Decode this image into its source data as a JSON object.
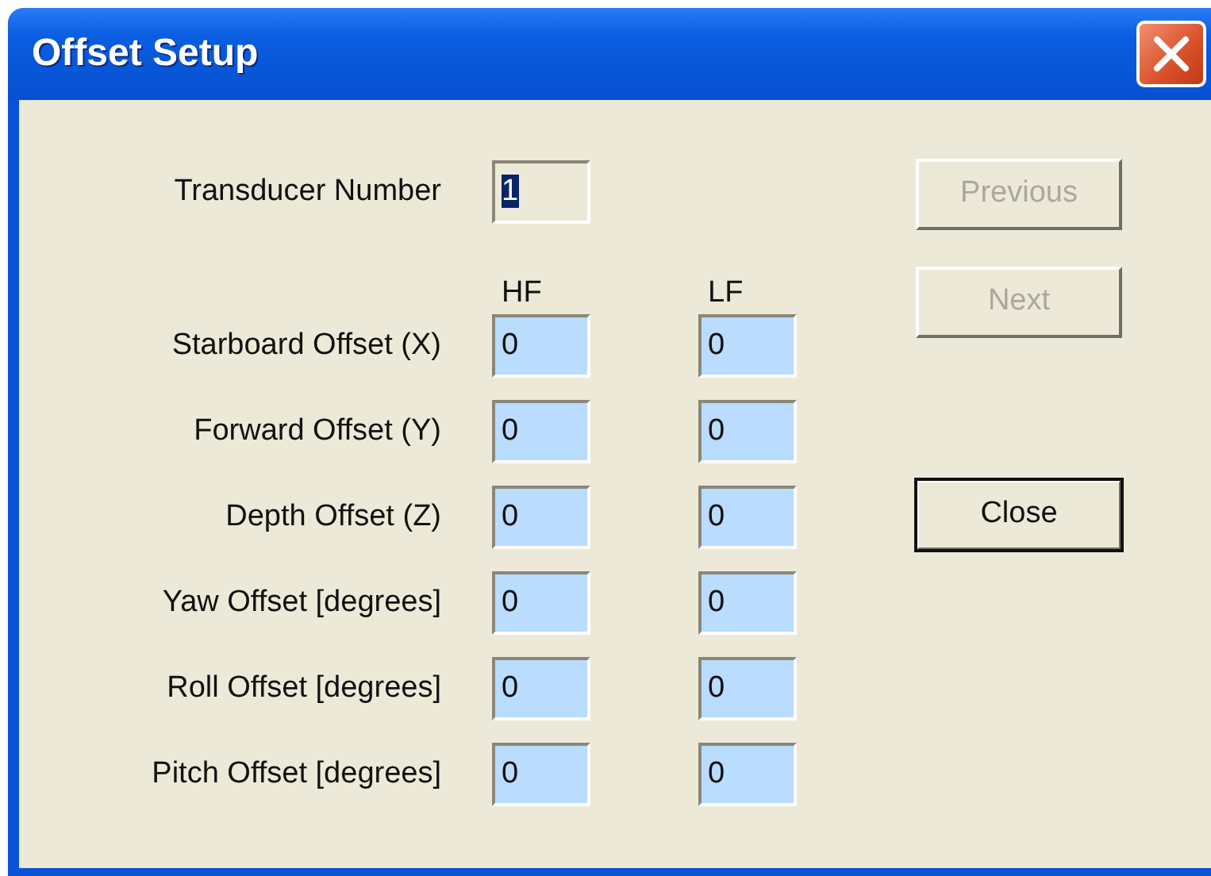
{
  "window": {
    "title": "Offset Setup"
  },
  "transducer": {
    "label": "Transducer Number",
    "value": "1",
    "text_selected": true
  },
  "columns": [
    "HF",
    "LF"
  ],
  "rows": [
    {
      "label": "Starboard Offset (X)",
      "hf": "0",
      "lf": "0"
    },
    {
      "label": "Forward Offset (Y)",
      "hf": "0",
      "lf": "0"
    },
    {
      "label": "Depth Offset (Z)",
      "hf": "0",
      "lf": "0"
    },
    {
      "label": "Yaw Offset [degrees]",
      "hf": "0",
      "lf": "0"
    },
    {
      "label": "Roll Offset [degrees]",
      "hf": "0",
      "lf": "0"
    },
    {
      "label": "Pitch Offset [degrees]",
      "hf": "0",
      "lf": "0"
    }
  ],
  "buttons": [
    {
      "label": "Previous",
      "disabled": true,
      "default": false
    },
    {
      "label": "Next",
      "disabled": true,
      "default": false
    },
    {
      "label": "Close",
      "disabled": false,
      "default": true
    }
  ]
}
